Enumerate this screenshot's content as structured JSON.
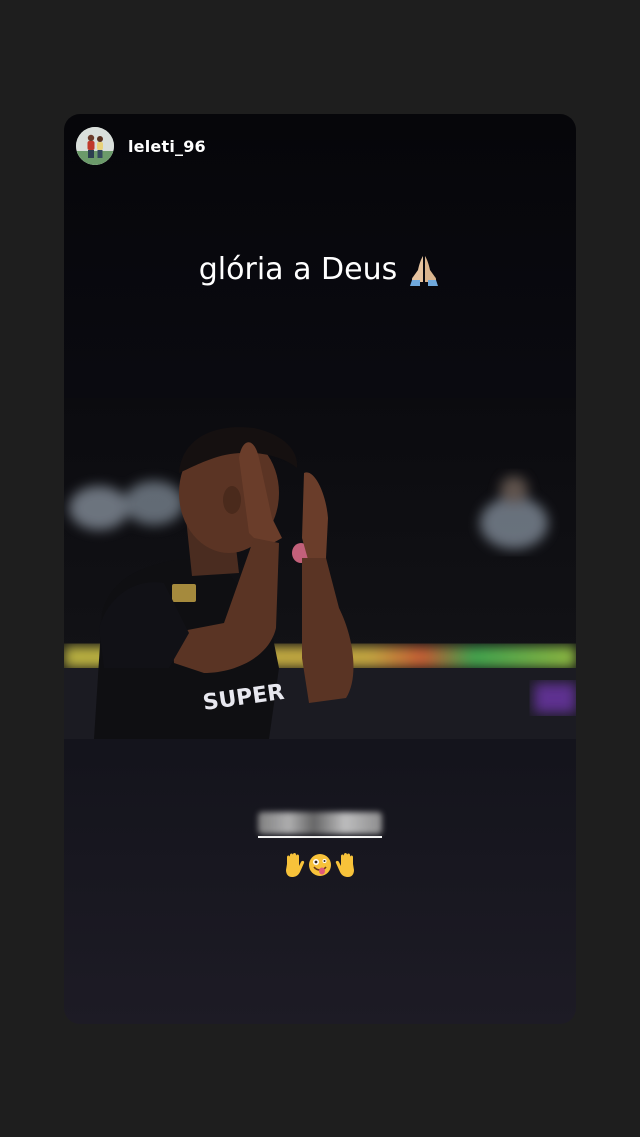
{
  "story": {
    "username": "leleti_96",
    "caption": "glória a Deus",
    "jersey_text": "SUPER"
  },
  "icons": {
    "avatar": "profile-avatar",
    "caption_emoji": "folded-hands-icon",
    "sticker_emojis": [
      "raised-hand-icon",
      "zany-face-icon",
      "raised-hand-icon"
    ]
  },
  "colors": {
    "page_background": "#1e1e1e",
    "story_background": "#0a0a10",
    "text": "#ffffff",
    "hand_yellow": "#f7c23a"
  }
}
